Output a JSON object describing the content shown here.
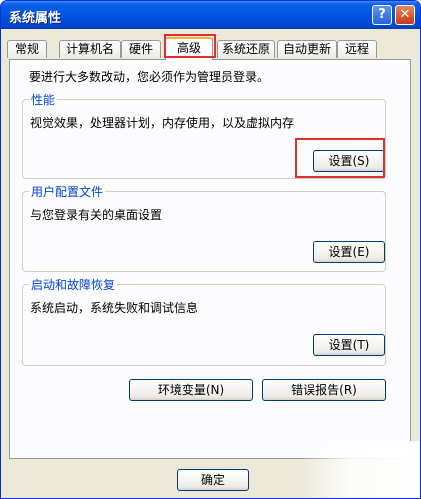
{
  "window": {
    "title": "系统属性",
    "help_label": "?",
    "close_label": "✕"
  },
  "tabs": [
    {
      "label": "常规"
    },
    {
      "label": "计算机名"
    },
    {
      "label": "硬件"
    },
    {
      "label": "高级",
      "active": true
    },
    {
      "label": "系统还原"
    },
    {
      "label": "自动更新"
    },
    {
      "label": "远程"
    }
  ],
  "panel": {
    "admin_note": "要进行大多数改动，您必须作为管理员登录。",
    "performance": {
      "label": "性能",
      "description": "视觉效果，处理器计划，内存使用，以及虚拟内存",
      "button": "设置(S)"
    },
    "user_profiles": {
      "label": "用户配置文件",
      "description": "与您登录有关的桌面设置",
      "button": "设置(E)"
    },
    "startup_recovery": {
      "label": "启动和故障恢复",
      "description": "系统启动，系统失败和调试信息",
      "button": "设置(T)"
    },
    "env_vars_button": "环境变量(N)",
    "error_report_button": "错误报告(R)"
  },
  "footer": {
    "ok_button": "确定"
  },
  "colors": {
    "titlebar": "#0055e5",
    "group_label": "#0046d5",
    "highlight": "#e02f2f",
    "active_tab_accent": "#f7b23d"
  }
}
